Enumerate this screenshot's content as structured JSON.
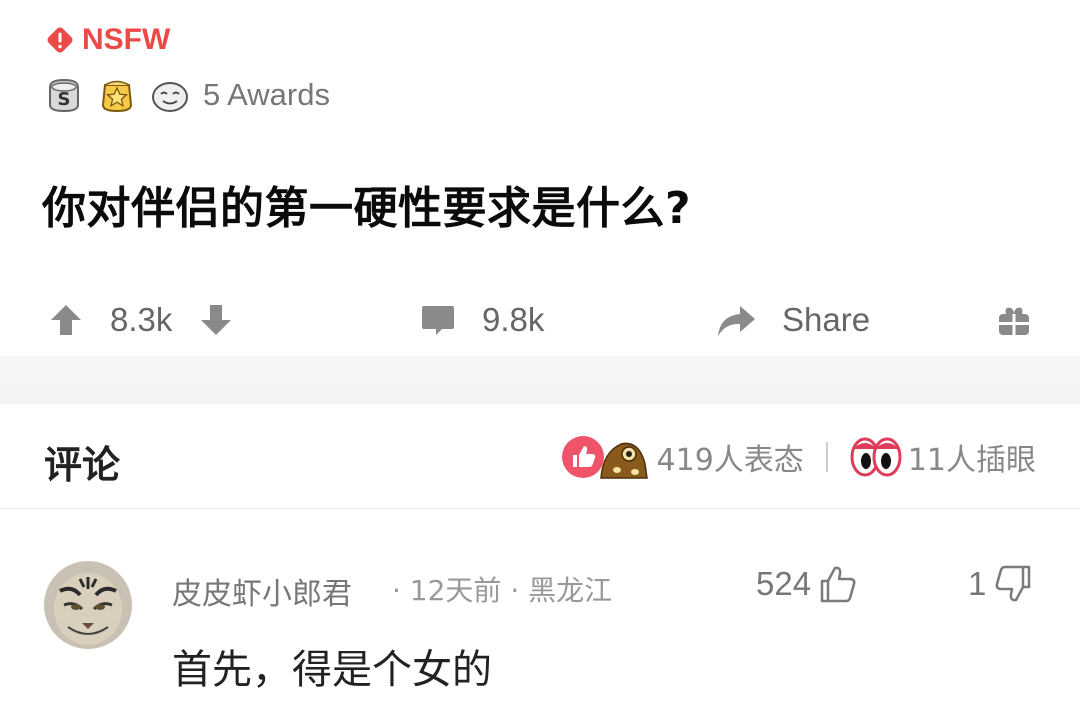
{
  "post": {
    "nsfw_label": "NSFW",
    "awards": {
      "icons": [
        "silver-s-award-icon",
        "gold-star-award-icon",
        "smile-face-award-icon"
      ],
      "label": "5 Awards"
    },
    "title": "你对伴侣的第一硬性要求是什么?",
    "actions": {
      "upvotes": "8.3k",
      "comments": "9.8k",
      "share": "Share"
    }
  },
  "comments_header": {
    "title": "评论",
    "reactions": "419人表态",
    "watchers": "11人插眼"
  },
  "comment": {
    "author": "皮皮虾小郎君",
    "meta": "· 12天前 · 黑龙江",
    "likes": "524",
    "dislikes": "1",
    "text": "首先，得是个女的"
  },
  "colors": {
    "nsfw": "#ec4a46",
    "icon_gray": "#9a9a9a",
    "reaction_pink": "#f0546b"
  }
}
